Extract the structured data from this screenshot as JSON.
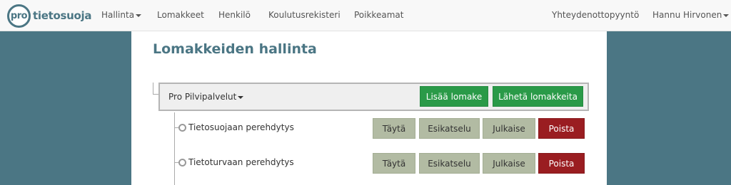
{
  "logo": {
    "badge": "pro",
    "text": "tietosuoja"
  },
  "nav": {
    "left": [
      {
        "label": "Hallinta",
        "has_caret": true
      },
      {
        "label": "Lomakkeet",
        "has_caret": false
      },
      {
        "label": "Henkilö",
        "has_caret": false
      },
      {
        "label": "Koulutusrekisteri",
        "has_caret": false
      },
      {
        "label": "Poikkeamat",
        "has_caret": false
      }
    ],
    "right": [
      {
        "label": "Yhteydenottopyyntö",
        "has_caret": false
      },
      {
        "label": "Hannu Hirvonen",
        "has_caret": true
      }
    ]
  },
  "page": {
    "title": "Lomakkeiden hallinta"
  },
  "group": {
    "label": "Pro Pilvipalvelut",
    "add_button": "Lisää lomake",
    "send_button": "Lähetä lomakkeita"
  },
  "forms": [
    {
      "name": "Tietosuojaan perehdytys",
      "fill": "Täytä",
      "preview": "Esikatselu",
      "publish": "Julkaise",
      "delete": "Poista"
    },
    {
      "name": "Tietoturvaan perehdytys",
      "fill": "Täytä",
      "preview": "Esikatselu",
      "publish": "Julkaise",
      "delete": "Poista"
    }
  ],
  "colors": {
    "brand": "#4b7684",
    "primary_green": "#2a9a48",
    "neutral_button": "#b2bba3",
    "danger_red": "#9a1d21"
  }
}
